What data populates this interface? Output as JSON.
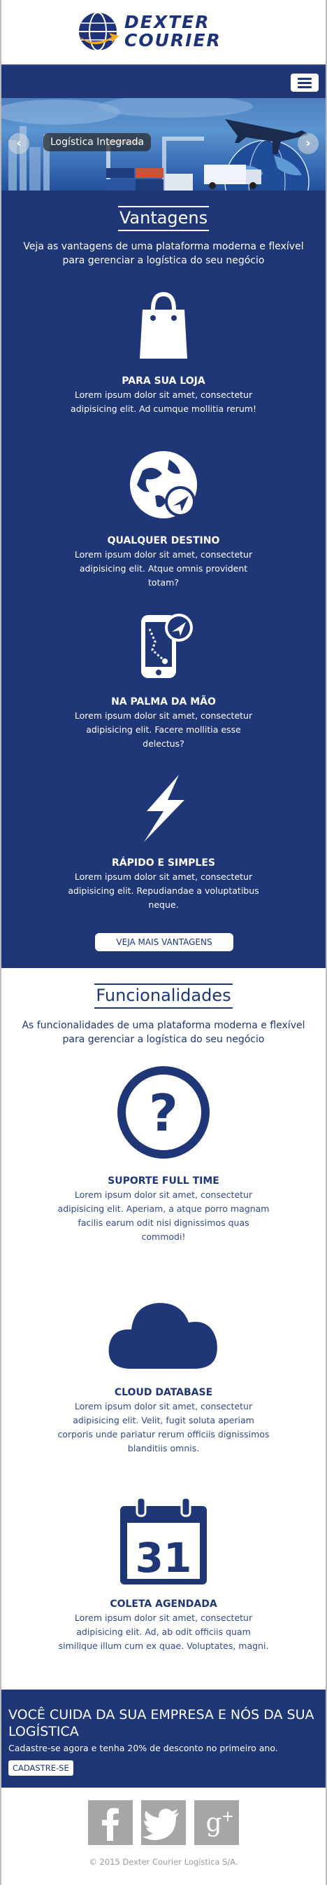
{
  "brand": {
    "line1": "DEXTER",
    "line2": "COURIER"
  },
  "navbar": {
    "toggle_icon": "hamburger-menu-icon"
  },
  "carousel": {
    "caption": "Logística Integrada",
    "prev": "‹",
    "next": "›"
  },
  "vantagens": {
    "title": "Vantagens",
    "subtitle": "Veja as vantagens de uma plataforma moderna e flexível para gerenciar a logística do seu negócio",
    "items": [
      {
        "icon": "shopping-bag-icon",
        "title": "PARA SUA LOJA",
        "text": "Lorem ipsum dolor sit amet, consectetur adipisicing elit. Ad cumque mollitia rerum!"
      },
      {
        "icon": "globe-location-icon",
        "title": "QUALQUER DESTINO",
        "text": "Lorem ipsum dolor sit amet, consectetur adipisicing elit. Atque omnis provident totam?"
      },
      {
        "icon": "mobile-map-icon",
        "title": "NA PALMA DA MÃO",
        "text": "Lorem ipsum dolor sit amet, consectetur adipisicing elit. Facere mollitia esse delectus?"
      },
      {
        "icon": "lightning-icon",
        "title": "RÁPIDO E SIMPLES",
        "text": "Lorem ipsum dolor sit amet, consectetur adipisicing elit. Repudiandae a voluptatibus neque."
      }
    ],
    "button": "VEJA MAIS VANTAGENS"
  },
  "funcionalidades": {
    "title": "Funcionalidades",
    "subtitle": "As funcionalidades de uma plataforma moderna e flexível para gerenciar a logística do seu negócio",
    "items": [
      {
        "icon": "question-circle-icon",
        "title": "SUPORTE FULL TIME",
        "text": "Lorem ipsum dolor sit amet, consectetur adipisicing elit. Aperiam, a atque porro magnam facilis earum odit nisi dignissimos quas commodi!"
      },
      {
        "icon": "cloud-icon",
        "title": "CLOUD DATABASE",
        "text": "Lorem ipsum dolor sit amet, consectetur adipisicing elit. Velit, fugit soluta aperiam corporis unde pariatur rerum officiis dignissimos blanditiis omnis."
      },
      {
        "icon": "calendar-icon",
        "calendar_day": "31",
        "title": "COLETA AGENDADA",
        "text": "Lorem ipsum dolor sit amet, consectetur adipisicing elit. Ad, ab odit officiis quam similique illum cum ex quae. Voluptates, magni."
      }
    ]
  },
  "cta": {
    "title": "VOCÊ CUIDA DA SUA EMPRESA E NÓS DA SUA LOGÍSTICA",
    "text": "Cadastre-se agora e tenha 20% de desconto no primeiro ano.",
    "button": "CADASTRE-SE"
  },
  "footer": {
    "social": [
      {
        "icon": "facebook-icon",
        "glyph": "f"
      },
      {
        "icon": "twitter-icon",
        "glyph": ""
      },
      {
        "icon": "google-plus-icon",
        "glyph": "g+"
      }
    ],
    "copyright": "© 2015 Dexter Courier Logística S/A."
  },
  "colors": {
    "primary": "#1f3677",
    "accent": "#f5a623",
    "footer_icon": "#a6a6a6"
  }
}
